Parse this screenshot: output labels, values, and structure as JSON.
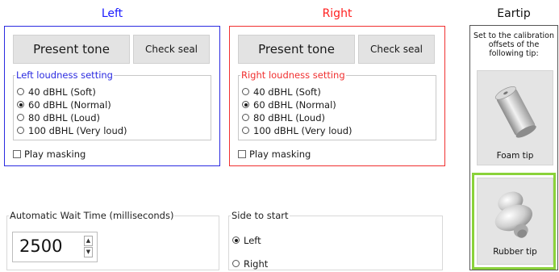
{
  "left": {
    "title": "Left",
    "title_color": "#1a1aff",
    "border_color": "#2b2be0",
    "present_tone_label": "Present tone",
    "check_seal_label": "Check seal",
    "loudness_legend": "Left loudness setting",
    "loudness_options": [
      "40 dBHL (Soft)",
      "60 dBHL (Normal)",
      "80 dBHL (Loud)",
      "100 dBHL (Very loud)"
    ],
    "selected_index": 1,
    "masking_label": "Play masking",
    "masking_checked": false
  },
  "right": {
    "title": "Right",
    "title_color": "#ff2020",
    "border_color": "#f03030",
    "present_tone_label": "Present tone",
    "check_seal_label": "Check seal",
    "loudness_legend": "Right loudness setting",
    "loudness_options": [
      "40 dBHL (Soft)",
      "60 dBHL (Normal)",
      "80 dBHL (Loud)",
      "100 dBHL (Very loud)"
    ],
    "selected_index": 1,
    "masking_label": "Play masking",
    "masking_checked": false
  },
  "eartip": {
    "title": "Eartip",
    "description": "Set to the calibration offsets of the following tip:",
    "foam_label": "Foam tip",
    "rubber_label": "Rubber tip",
    "selected": "Rubber tip",
    "selected_color": "#8ad23a"
  },
  "wait_time": {
    "legend": "Automatic Wait Time (milliseconds)",
    "value": "2500"
  },
  "side_to_start": {
    "legend": "Side to start",
    "options": [
      "Left",
      "Right"
    ],
    "selected": "Left"
  }
}
